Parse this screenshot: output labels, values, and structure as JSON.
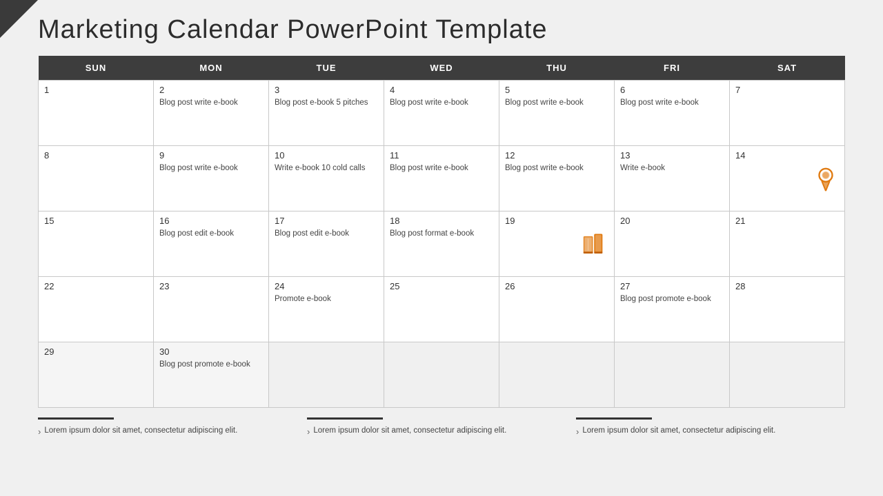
{
  "title": "Marketing Calendar PowerPoint Template",
  "header": {
    "days": [
      "SUN",
      "MON",
      "TUE",
      "WED",
      "THU",
      "FRI",
      "SAT"
    ]
  },
  "weeks": [
    [
      {
        "num": "1",
        "text": ""
      },
      {
        "num": "2",
        "text": "Blog post write e-book"
      },
      {
        "num": "3",
        "text": "Blog post e-book 5 pitches"
      },
      {
        "num": "4",
        "text": "Blog post write e-book"
      },
      {
        "num": "5",
        "text": "Blog post write e-book"
      },
      {
        "num": "6",
        "text": "Blog post write e-book"
      },
      {
        "num": "7",
        "text": ""
      }
    ],
    [
      {
        "num": "8",
        "text": ""
      },
      {
        "num": "9",
        "text": "Blog post write e-book"
      },
      {
        "num": "10",
        "text": "Write e-book 10 cold calls"
      },
      {
        "num": "11",
        "text": "Blog post write e-book"
      },
      {
        "num": "12",
        "text": "Blog post write e-book"
      },
      {
        "num": "13",
        "text": "Write e-book"
      },
      {
        "num": "14",
        "text": "",
        "icon": "award"
      }
    ],
    [
      {
        "num": "15",
        "text": ""
      },
      {
        "num": "16",
        "text": "Blog post edit e-book"
      },
      {
        "num": "17",
        "text": "Blog post edit e-book"
      },
      {
        "num": "18",
        "text": "Blog post format e-book"
      },
      {
        "num": "19",
        "text": "",
        "icon": "book"
      },
      {
        "num": "20",
        "text": ""
      },
      {
        "num": "21",
        "text": ""
      }
    ],
    [
      {
        "num": "22",
        "text": ""
      },
      {
        "num": "23",
        "text": ""
      },
      {
        "num": "24",
        "text": "Promote e-book"
      },
      {
        "num": "25",
        "text": ""
      },
      {
        "num": "26",
        "text": ""
      },
      {
        "num": "27",
        "text": "Blog post promote e-book"
      },
      {
        "num": "28",
        "text": ""
      }
    ],
    [
      {
        "num": "29",
        "text": ""
      },
      {
        "num": "30",
        "text": "Blog post promote e-book"
      },
      {
        "num": "",
        "text": ""
      },
      {
        "num": "",
        "text": ""
      },
      {
        "num": "",
        "text": ""
      },
      {
        "num": "",
        "text": ""
      },
      {
        "num": "",
        "text": ""
      }
    ]
  ],
  "footer": [
    {
      "line": true,
      "text": "Lorem ipsum dolor sit amet, consectetur adipiscing elit."
    },
    {
      "line": true,
      "text": "Lorem ipsum dolor sit amet, consectetur adipiscing elit."
    },
    {
      "line": true,
      "text": "Lorem ipsum dolor sit amet, consectetur adipiscing elit."
    }
  ]
}
